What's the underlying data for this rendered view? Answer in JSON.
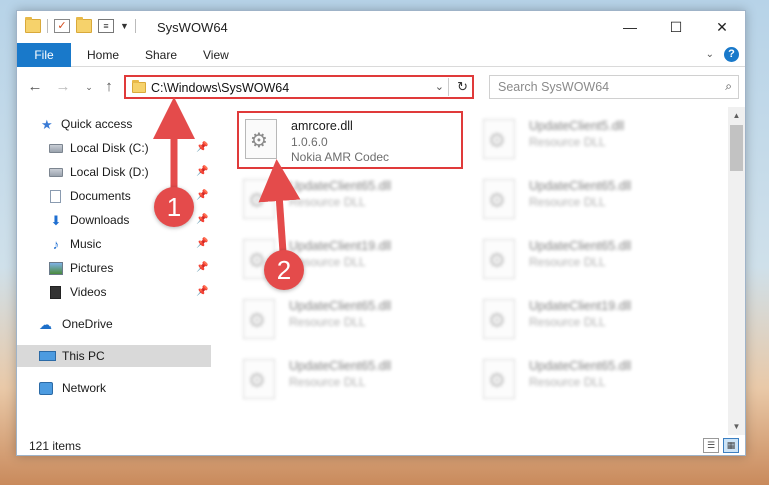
{
  "window": {
    "title": "SysWOW64",
    "controls": {
      "minimize": "—",
      "maximize": "☐",
      "close": "✕"
    }
  },
  "ribbon": {
    "tabs": [
      "File",
      "Home",
      "Share",
      "View"
    ],
    "help": "?"
  },
  "nav": {
    "address": "C:\\Windows\\SysWOW64",
    "search_placeholder": "Search SysWOW64"
  },
  "sidebar": {
    "items": [
      {
        "label": "Quick access",
        "icon": "star-icon",
        "pinned": false
      },
      {
        "label": "Local Disk (C:)",
        "icon": "drive-icon",
        "pinned": true
      },
      {
        "label": "Local Disk (D:)",
        "icon": "drive-icon",
        "pinned": true
      },
      {
        "label": "Documents",
        "icon": "documents-icon",
        "pinned": true
      },
      {
        "label": "Downloads",
        "icon": "downloads-icon",
        "pinned": true
      },
      {
        "label": "Music",
        "icon": "music-icon",
        "pinned": true
      },
      {
        "label": "Pictures",
        "icon": "pictures-icon",
        "pinned": true
      },
      {
        "label": "Videos",
        "icon": "videos-icon",
        "pinned": true
      },
      {
        "label": "OneDrive",
        "icon": "cloud-icon",
        "pinned": false
      },
      {
        "label": "This PC",
        "icon": "computer-icon",
        "pinned": false,
        "selected": true
      },
      {
        "label": "Network",
        "icon": "network-icon",
        "pinned": false
      }
    ]
  },
  "files": [
    {
      "name": "amrcore.dll",
      "line1": "1.0.6.0",
      "line2": "Nokia AMR Codec",
      "highlighted": true
    },
    {
      "name": "UpdateClient5.dll",
      "line1": "Resource DLL",
      "line2": ""
    },
    {
      "name": "UpdateClient65.dll",
      "line1": "Resource DLL",
      "line2": ""
    },
    {
      "name": "UpdateClient65.dll",
      "line1": "Resource DLL",
      "line2": ""
    },
    {
      "name": "UpdateClient19.dll",
      "line1": "Resource DLL",
      "line2": ""
    },
    {
      "name": "UpdateClient65.dll",
      "line1": "Resource DLL",
      "line2": ""
    },
    {
      "name": "UpdateClient65.dll",
      "line1": "Resource DLL",
      "line2": ""
    },
    {
      "name": "UpdateClient19.dll",
      "line1": "Resource DLL",
      "line2": ""
    },
    {
      "name": "UpdateClient65.dll",
      "line1": "Resource DLL",
      "line2": ""
    },
    {
      "name": "UpdateClient65.dll",
      "line1": "Resource DLL",
      "line2": ""
    }
  ],
  "status": {
    "item_count": "121 items"
  },
  "annotations": {
    "step1": "1",
    "step2": "2",
    "accent": "#e44b4b"
  }
}
